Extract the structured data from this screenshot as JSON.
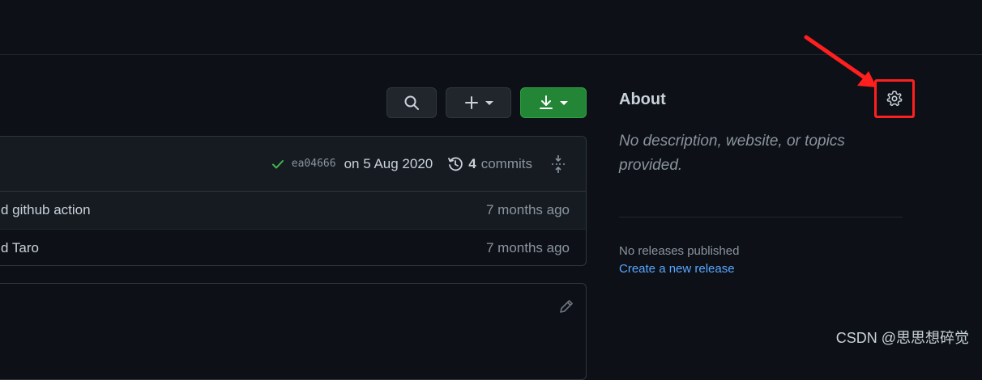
{
  "toolbar": {
    "search_icon": "search-icon",
    "add_icon": "plus-icon",
    "code_icon": "download-icon"
  },
  "latest_commit": {
    "sha": "ea04666",
    "date": "on 5 Aug 2020",
    "commit_count": "4",
    "commits_label": "commits",
    "status_color": "#3fb950"
  },
  "files": [
    {
      "message": "d github action",
      "age": "7 months ago"
    },
    {
      "message": "d Taro",
      "age": "7 months ago"
    }
  ],
  "about": {
    "title": "About",
    "description": "No description, website, or topics provided.",
    "settings_icon": "gear-icon"
  },
  "releases": {
    "status": "No releases published",
    "link": "Create a new release"
  },
  "watermark": "CSDN @思思想碎觉",
  "colors": {
    "background": "#0d1117",
    "accent_green": "#238636",
    "link": "#58a6ff",
    "highlight": "#ff1f1f"
  }
}
